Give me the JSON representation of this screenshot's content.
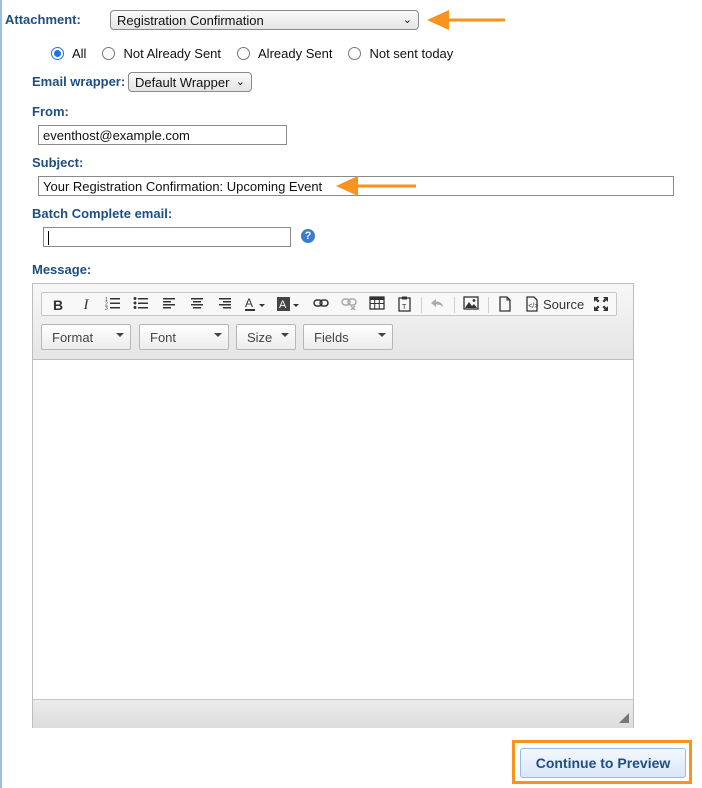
{
  "form": {
    "attachment_label": "Attachment:",
    "attachment_value": "Registration Confirmation",
    "filter_options": [
      {
        "label": "All",
        "selected": true
      },
      {
        "label": "Not Already Sent",
        "selected": false
      },
      {
        "label": "Already Sent",
        "selected": false
      },
      {
        "label": "Not sent today",
        "selected": false
      }
    ],
    "wrapper_label": "Email wrapper:",
    "wrapper_value": "Default Wrapper",
    "from_label": "From:",
    "from_value": "eventhost@example.com",
    "subject_label": "Subject:",
    "subject_value": "Your Registration Confirmation: Upcoming Event",
    "batch_label": "Batch Complete email:",
    "batch_value": "",
    "help_glyph": "?",
    "message_label": "Message:"
  },
  "editor": {
    "source_label": "Source",
    "combos": [
      "Format",
      "Font",
      "Size",
      "Fields"
    ]
  },
  "actions": {
    "continue_label": "Continue to Preview"
  },
  "colors": {
    "label": "#1f4e80",
    "annotation_arrow": "#f7931e",
    "radio_selected": "#1a73e8"
  }
}
